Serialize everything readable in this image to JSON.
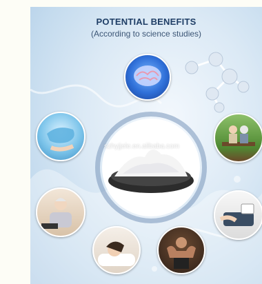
{
  "header": {
    "title": "POTENTIAL BENEFITS",
    "subtitle": "(According to science studies)"
  },
  "watermark": "szhyjjele.en.alibaba.com",
  "colors": {
    "title": "#1f3e66",
    "background_water": "#c4dbee"
  },
  "icons": [
    "brain-icon",
    "liver-icon",
    "elderly-couple-icon",
    "senior-woman-icon",
    "blood-pressure-icon",
    "sleeping-woman-icon",
    "muscle-man-icon",
    "molecule-icon",
    "powder-dish-icon"
  ]
}
